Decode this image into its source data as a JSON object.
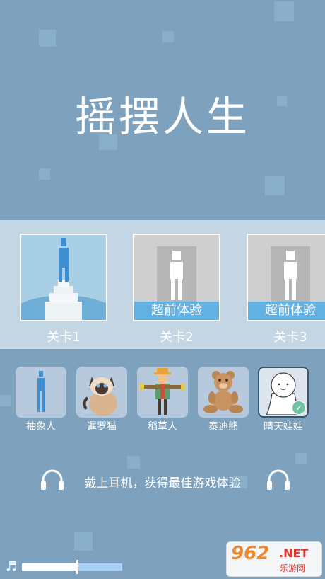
{
  "title": "摇摆人生",
  "levels": [
    {
      "label": "关卡1",
      "badge": ""
    },
    {
      "label": "关卡2",
      "badge": "超前体验"
    },
    {
      "label": "关卡3",
      "badge": "超前体验"
    }
  ],
  "characters": [
    {
      "label": "抽象人",
      "icon": "abstract-figure-icon"
    },
    {
      "label": "暹罗猫",
      "icon": "siamese-cat-icon"
    },
    {
      "label": "稻草人",
      "icon": "scarecrow-icon"
    },
    {
      "label": "泰迪熊",
      "icon": "teddy-bear-icon"
    },
    {
      "label": "晴天娃娃",
      "icon": "teru-teru-bozu-icon",
      "selected": true
    }
  ],
  "tip": "戴上耳机，获得最佳游戏体验",
  "volume": 0.55,
  "watermark": {
    "num": "962",
    "net": ".NET",
    "site": "乐游网"
  },
  "colors": {
    "background": "#7ea2bd",
    "band": "#c4d6e3",
    "badge": "#63b0e3"
  }
}
